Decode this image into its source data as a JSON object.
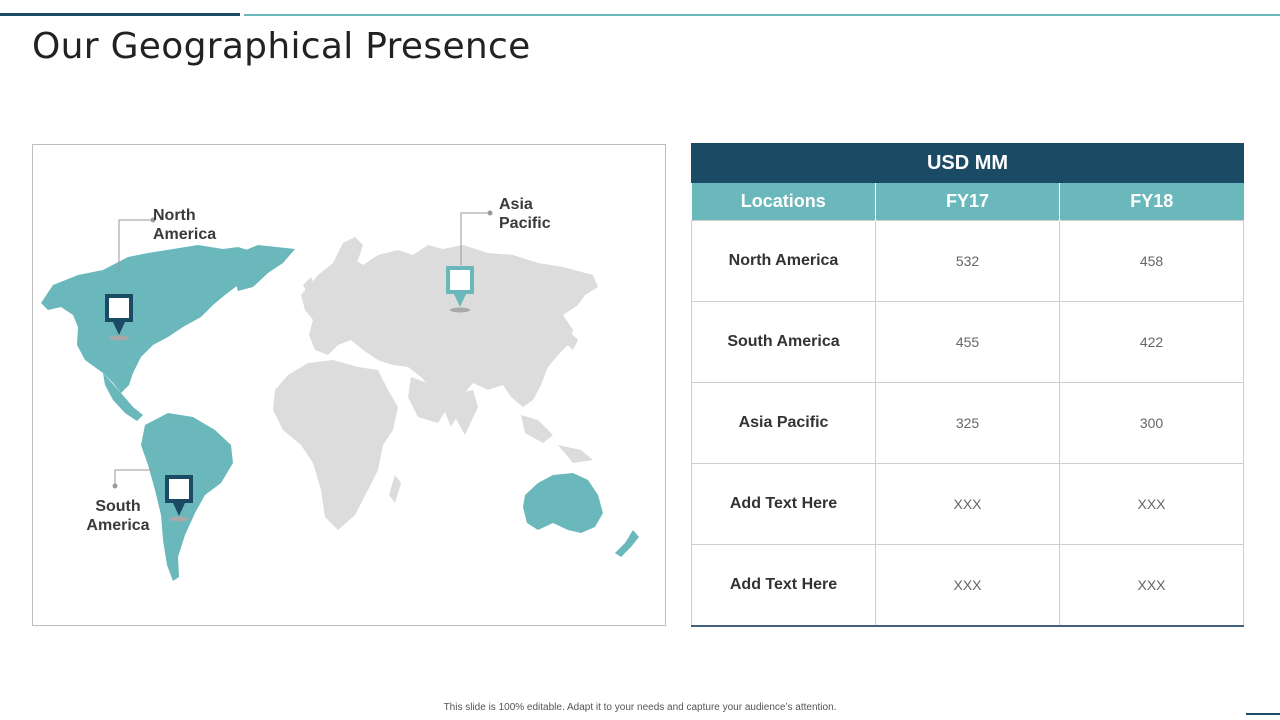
{
  "title": "Our Geographical Presence",
  "colors": {
    "navy": "#1b4a64",
    "teal": "#6ab8bc",
    "land_grey": "#dcdcdc"
  },
  "map": {
    "labels": {
      "north_america": [
        "North",
        "America"
      ],
      "asia_pacific": [
        "Asia",
        "Pacific"
      ],
      "south_america": [
        "South",
        "America"
      ]
    },
    "highlighted_regions": [
      "North America",
      "South America",
      "Australia"
    ]
  },
  "table": {
    "group_header": "USD MM",
    "columns": [
      "Locations",
      "FY17",
      "FY18"
    ],
    "rows": [
      {
        "location": "North America",
        "fy17": "532",
        "fy18": "458"
      },
      {
        "location": "South America",
        "fy17": "455",
        "fy18": "422"
      },
      {
        "location": "Asia Pacific",
        "fy17": "325",
        "fy18": "300"
      },
      {
        "location": "Add Text Here",
        "fy17": "XXX",
        "fy18": "XXX"
      },
      {
        "location": "Add Text Here",
        "fy17": "XXX",
        "fy18": "XXX"
      }
    ]
  },
  "footer": "This slide is 100% editable. Adapt it to your needs and capture your audience’s attention."
}
